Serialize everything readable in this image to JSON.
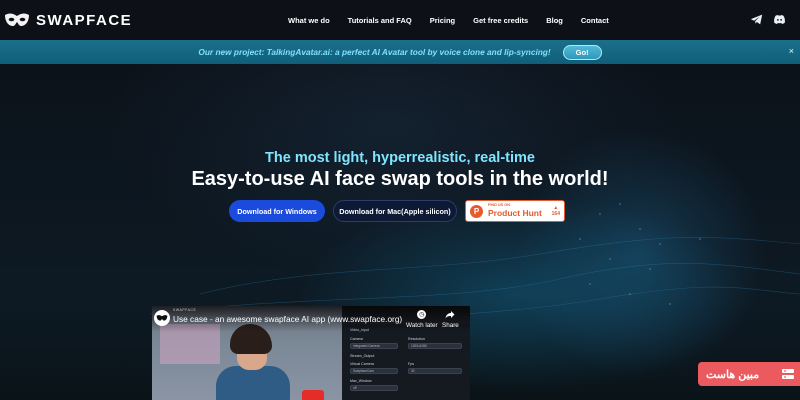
{
  "header": {
    "brand": "SWAPFACE",
    "nav": [
      "What we do",
      "Tutorials and FAQ",
      "Pricing",
      "Get free credits",
      "Blog",
      "Contact"
    ],
    "icons": [
      "telegram-icon",
      "discord-icon"
    ]
  },
  "banner": {
    "text": "Our new project: TalkingAvatar.ai: a perfect AI Avatar tool by voice clone and lip-syncing!",
    "cta": "Go!",
    "close": "×"
  },
  "hero": {
    "subtitle": "The most light, hyperrealistic, real-time",
    "title": "Easy-to-use AI face swap tools in the world!",
    "buttons": {
      "windows": "Download for Windows",
      "mac": "Download for Mac(Apple silicon)"
    },
    "product_hunt": {
      "find_text": "FIND US ON",
      "name": "Product Hunt",
      "votes": "164"
    }
  },
  "video": {
    "channel": "SWAPFACE",
    "title": "Use case - an awesome swapface AI app (www.swapface.org)",
    "watch_later": "Watch later",
    "share": "Share",
    "app_panel": {
      "video_input": "Video_input",
      "camera": "Camera",
      "camera_value": "Integrated Camera",
      "resolution": "Resolution",
      "resolution_value": "1920x1080",
      "stream_output": "Stream_Output",
      "virtual_camera": "Virtual Camera",
      "virtual_camera_value": "SwapfaceCam",
      "fps": "Fps",
      "fps_value": "30",
      "max_window": "Max_Window",
      "max_window_value": "off"
    }
  },
  "watermark": {
    "text": "مبین هاست"
  },
  "colors": {
    "nav_bg": "#0d1117",
    "banner_bg": "#1c6f8a",
    "banner_text": "#7fe0ff",
    "subtitle": "#7fe6ff",
    "windows_button": "#1b4bdc",
    "mac_button": "#0e1a35",
    "product_hunt": "#e65a2c",
    "watermark": "#ea5a5f"
  }
}
